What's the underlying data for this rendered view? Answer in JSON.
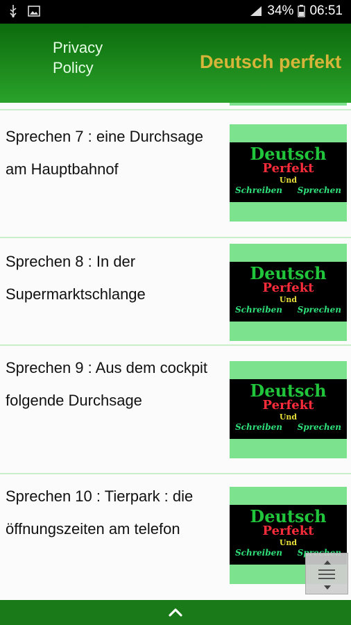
{
  "status_bar": {
    "battery": "34%",
    "time": "06:51",
    "icons": [
      "usb-icon",
      "image-icon",
      "signal-icon",
      "battery-icon"
    ]
  },
  "app_bar": {
    "privacy_policy": "Privacy\nPolicy",
    "title": "Deutsch perfekt",
    "colors": {
      "bar_dark": "#0c6a0c",
      "bar_light": "#2aa32a",
      "title": "#d7b43a"
    }
  },
  "thumbnail": {
    "line1": "Deutsch",
    "line2": "Perfekt",
    "line3": "Und",
    "line4_left": "Schreiben",
    "line4_right": "Sprechen",
    "bg": "#7de28e"
  },
  "items": [
    {
      "label": "Sprechen 7 : eine Durchsage am Hauptbahnof"
    },
    {
      "label": "Sprechen 8 : In der Supermarktschlange"
    },
    {
      "label": "Sprechen 9 : Aus dem cockpit folgende Durchsage"
    },
    {
      "label": "Sprechen 10 : Tierpark : die öffnungszeiten am telefon"
    }
  ],
  "bottom_bar": {
    "icon": "chevron-up-icon"
  },
  "floating_menu": {
    "icon": "menu-icon"
  }
}
